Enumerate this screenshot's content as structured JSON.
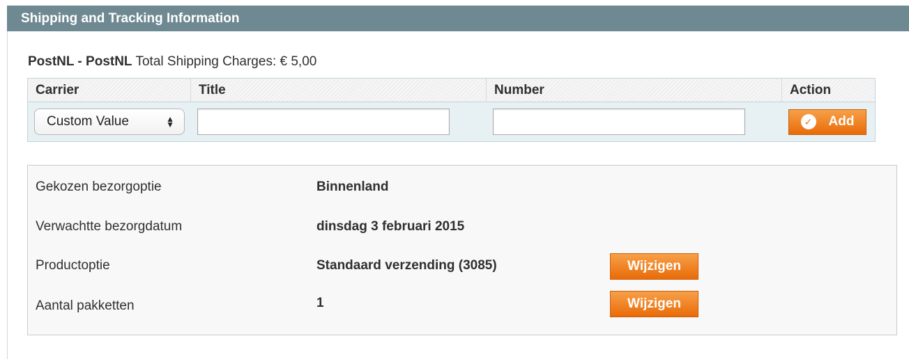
{
  "section": {
    "title": "Shipping and Tracking Information"
  },
  "summary": {
    "method": "PostNL - PostNL",
    "charges_label": "Total Shipping Charges:",
    "charges_value": "€ 5,00"
  },
  "tracking_table": {
    "headers": [
      "Carrier",
      "Title",
      "Number",
      "Action"
    ],
    "carrier_select": {
      "selected": "Custom Value"
    },
    "title_input": {
      "value": ""
    },
    "number_input": {
      "value": ""
    },
    "add_button": {
      "label": "Add",
      "icon": "check-circle-icon"
    }
  },
  "postnl_info": [
    {
      "label": "Gekozen bezorgoptie",
      "value": "Binnenland"
    },
    {
      "label": "Verwachtte bezorgdatum",
      "value": "dinsdag 3 februari 2015"
    },
    {
      "label": "Productoptie",
      "value": "Standaard verzending (3085)",
      "button": "Wijzigen"
    },
    {
      "label": "Aantal pakketten",
      "value": "1",
      "button": "Wijzigen"
    }
  ],
  "colors": {
    "header_bg": "#6f8992",
    "button_orange": "#ee7a1a",
    "table_row_bg": "#e7f1f4"
  }
}
